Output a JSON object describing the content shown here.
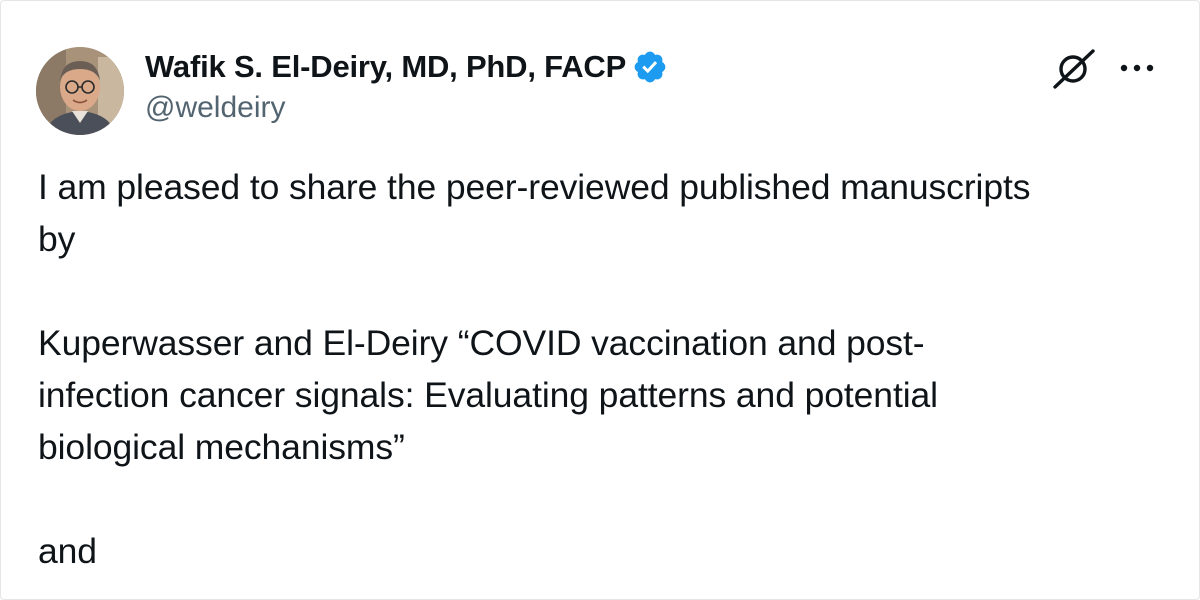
{
  "author": {
    "display_name": "Wafik S. El-Deiry, MD, PhD, FACP",
    "handle": "@weldeiry",
    "verified": true
  },
  "tweet": {
    "paragraph_1": "I am pleased to share the peer-reviewed published manuscripts\nby",
    "paragraph_2": "Kuperwasser and El-Deiry “COVID vaccination and post-\ninfection cancer signals: Evaluating patterns and potential\nbiological mechanisms”",
    "paragraph_3": "and"
  },
  "icons": {
    "verified": "verified-badge-icon",
    "platform": "x-logo-icon",
    "more": "more-options-icon"
  },
  "colors": {
    "verified_blue": "#1d9bf0",
    "text_primary": "#0f1419",
    "text_secondary": "#536471"
  }
}
